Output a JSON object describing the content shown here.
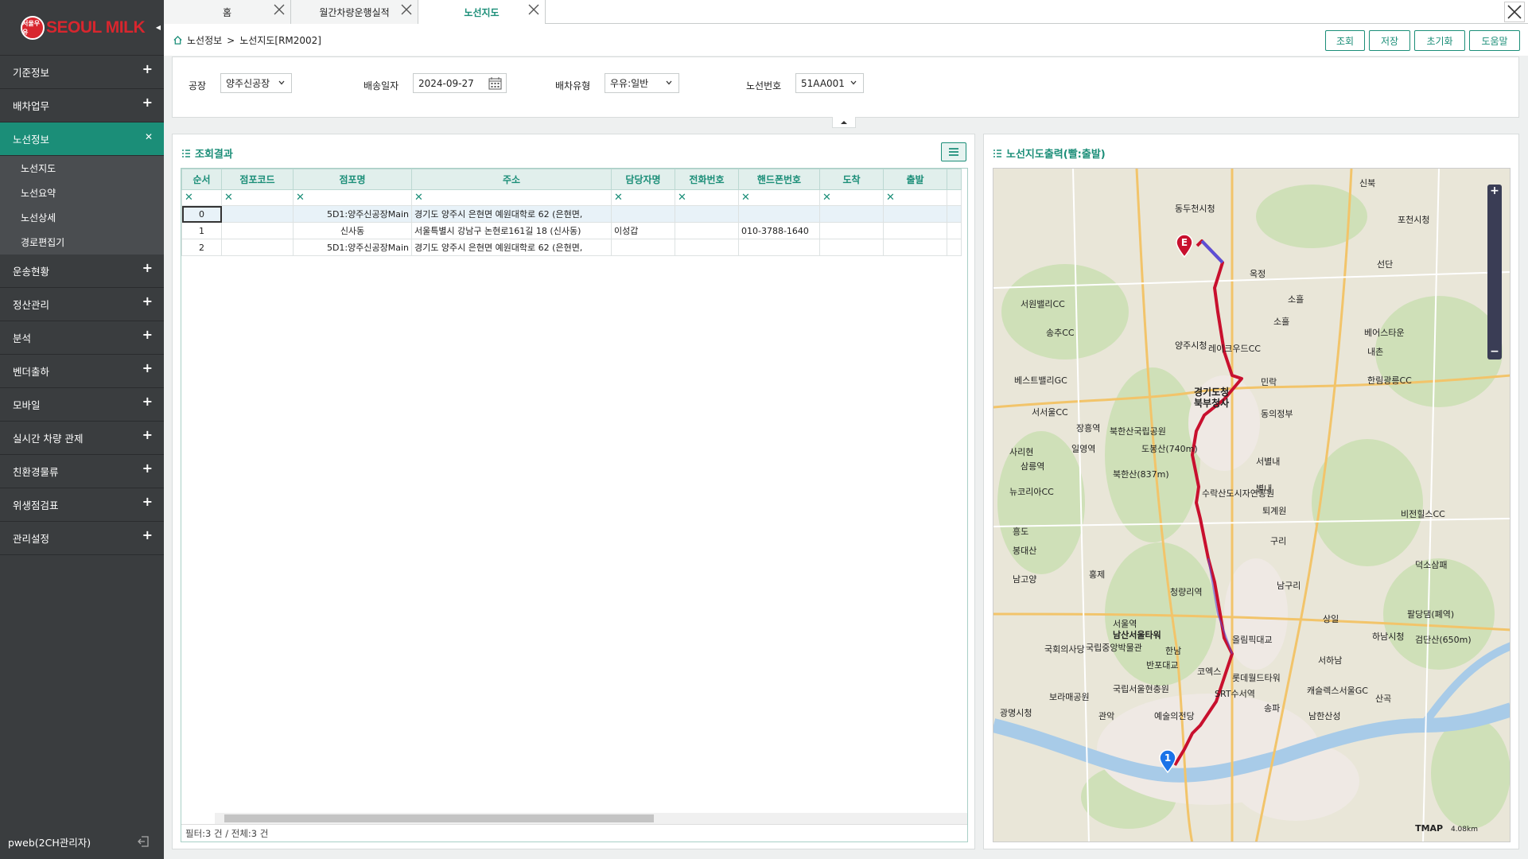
{
  "sidebar": {
    "logo_text": "SEOUL MILK",
    "logo_mark": "서울우유",
    "menu": [
      {
        "label": "기준정보"
      },
      {
        "label": "배차업무"
      },
      {
        "label": "노선정보"
      },
      {
        "label": "운송현황"
      },
      {
        "label": "정산관리"
      },
      {
        "label": "분석"
      },
      {
        "label": "벤더출하"
      },
      {
        "label": "모바일"
      },
      {
        "label": "실시간 차량 관제"
      },
      {
        "label": "친환경물류"
      },
      {
        "label": "위생점검표"
      },
      {
        "label": "관리설정"
      }
    ],
    "submenu": [
      "노선지도",
      "노선요약",
      "노선상세",
      "경로편집기"
    ],
    "user": "pweb(2CH관리자)"
  },
  "tabs": [
    "홈",
    "월간차량운행실적",
    "노선지도"
  ],
  "breadcrumb": {
    "parent": "노선정보",
    "sep": ">",
    "current": "노선지도[RM2002]"
  },
  "buttons": {
    "search": "조회",
    "save": "저장",
    "reset": "초기화",
    "help": "도움말"
  },
  "filter": {
    "factory_label": "공장",
    "factory_value": "양주신공장",
    "date_label": "배송일자",
    "date_value": "2024-09-27",
    "type_label": "배차유형",
    "type_value": "우유:일반",
    "route_label": "노선번호",
    "route_value": "51AA001"
  },
  "grid": {
    "title": "조회결과",
    "columns": [
      "순서",
      "점포코드",
      "점포명",
      "주소",
      "담당자명",
      "전화번호",
      "핸드폰번호",
      "도착",
      "출발"
    ],
    "filter_mark": "✕",
    "rows": [
      {
        "seq": "0",
        "code": "",
        "name": "5D1:양주신공장Main",
        "addr": "경기도 양주시 은현면 예원대학로 62 (은현면,",
        "manager": "",
        "tel": "",
        "mobile": "",
        "arrive": "",
        "depart": ""
      },
      {
        "seq": "1",
        "code": "",
        "name": "신사동",
        "addr": "서울특별시 강남구 논현로161길 18 (신사동)",
        "manager": "이성갑",
        "tel": "",
        "mobile": "010-3788-1640",
        "arrive": "",
        "depart": ""
      },
      {
        "seq": "2",
        "code": "",
        "name": "5D1:양주신공장Main",
        "addr": "경기도 양주시 은현면 예원대학로 62 (은현면,",
        "manager": "",
        "tel": "",
        "mobile": "",
        "arrive": "",
        "depart": ""
      }
    ],
    "footer": "필터:3 건 / 전체:3 건"
  },
  "map": {
    "title": "노선지도출력(빨:출발)",
    "start_marker": "1",
    "end_marker": "E",
    "brand": "TMAP",
    "scale": "4.08km",
    "labels": [
      "동두천시청",
      "포천시청",
      "신북",
      "선단",
      "옥정",
      "소흘",
      "서원밸리CC",
      "송추CC",
      "소흘",
      "양주시청",
      "레이크우드CC",
      "베어스타운",
      "내촌",
      "베스트밸리GC",
      "민락",
      "한림광릉CC",
      "경기도청",
      "북부청사",
      "서서울CC",
      "동의정부",
      "장흥역",
      "북한산국립공원",
      "도봉산(740m)",
      "일영역",
      "사리현",
      "삼릉역",
      "서별내",
      "북한산(837m)",
      "별내",
      "뉴코리아CC",
      "수락산도시자연공원",
      "퇴계원",
      "비전힐스CC",
      "흥도",
      "구리",
      "봉대산",
      "덕소삼패",
      "남구리",
      "홍제",
      "남고양",
      "청량리역",
      "서울역",
      "남산서울타워",
      "국회의사당",
      "국립중앙박물관",
      "한남",
      "올림픽대교",
      "하남시청",
      "서하남",
      "반포대교",
      "롯데월드타워",
      "코엑스",
      "SRT수서역",
      "캐슬렉스서울GC",
      "국립서울현충원",
      "보라매공원",
      "광명시청",
      "관악",
      "예술의전당",
      "산곡",
      "남한산성",
      "송파",
      "상일",
      "검단산(650m)",
      "팔당댐(폐역)"
    ]
  },
  "colors": {
    "accent": "#1b8e78",
    "route": "#c8102e",
    "sidebar": "#3a3d3f"
  }
}
